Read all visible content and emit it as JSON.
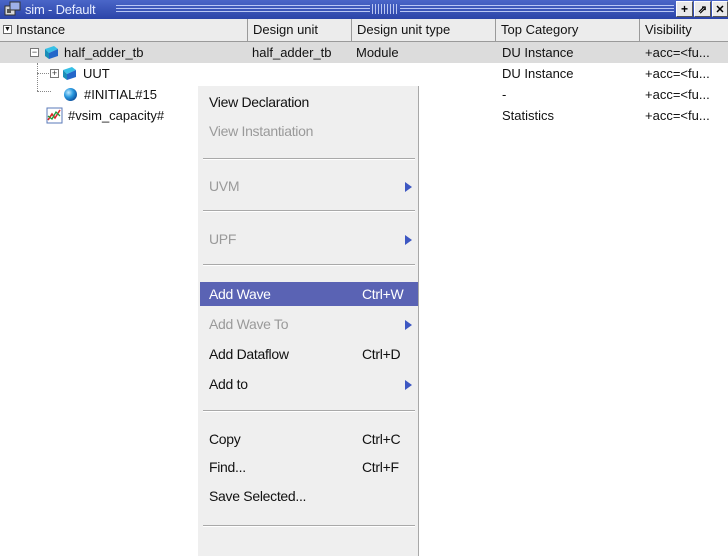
{
  "window": {
    "title": "sim - Default"
  },
  "title_buttons": {
    "add": "+",
    "float": "⇗",
    "close": "✕"
  },
  "columns": [
    "Instance",
    "Design unit",
    "Design unit type",
    "Top Category",
    "Visibility"
  ],
  "rows": [
    {
      "instance": "half_adder_tb",
      "design_unit": "half_adder_tb",
      "design_unit_type": "Module",
      "top_category": "DU Instance",
      "visibility": "+acc=<fu..."
    },
    {
      "instance": "UUT",
      "design_unit": "",
      "design_unit_type": "",
      "top_category": "DU Instance",
      "visibility": "+acc=<fu..."
    },
    {
      "instance": "#INITIAL#15",
      "design_unit": "",
      "design_unit_type": "s",
      "top_category": "-",
      "visibility": "+acc=<fu..."
    },
    {
      "instance": "#vsim_capacity#",
      "design_unit": "",
      "design_unit_type": "y",
      "top_category": "Statistics",
      "visibility": "+acc=<fu..."
    }
  ],
  "context_menu": {
    "view_declaration": "View Declaration",
    "view_instantiation": "View Instantiation",
    "uvm": "UVM",
    "upf": "UPF",
    "add_wave": "Add Wave",
    "add_wave_shortcut": "Ctrl+W",
    "add_wave_to": "Add Wave To",
    "add_dataflow": "Add Dataflow",
    "add_dataflow_shortcut": "Ctrl+D",
    "add_to": "Add to",
    "copy": "Copy",
    "copy_shortcut": "Ctrl+C",
    "find": "Find...",
    "find_shortcut": "Ctrl+F",
    "save_selected": "Save Selected..."
  },
  "colors": {
    "titlebar": "#2b44a8",
    "menu_highlight": "#5a63b4",
    "submenu_arrow": "#3d57c2"
  }
}
